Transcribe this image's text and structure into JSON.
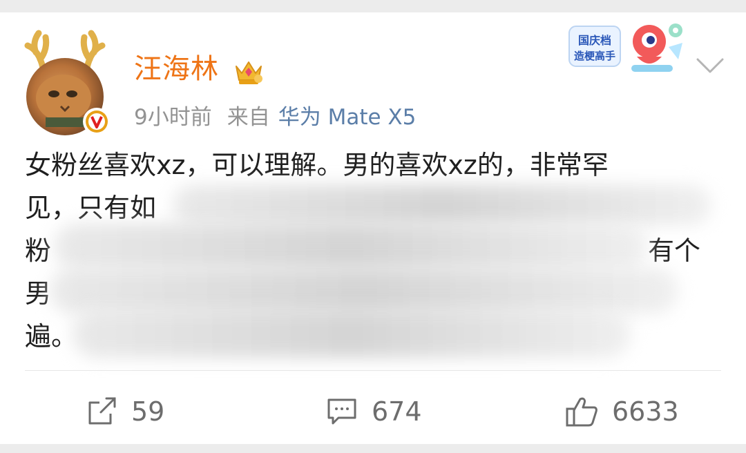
{
  "post": {
    "author": "汪海林",
    "time": "9小时前",
    "from_label": "来自",
    "device": "华为 Mate X5",
    "sticker_text_line1": "国庆档",
    "sticker_text_line2": "造梗高手",
    "content_lines": [
      "女粉丝喜欢xz，可以理解。男的喜欢xz的，非常罕",
      "见，只有如",
      "粉",
      "男",
      "遍。"
    ],
    "content_line2_tail": "有个"
  },
  "actions": {
    "repost_count": "59",
    "comment_count": "674",
    "like_count": "6633"
  },
  "colors": {
    "username": "#ee7416",
    "device_link": "#5b7ea8",
    "muted": "#939393",
    "verified_badge": "#e8a016"
  },
  "icons": {
    "repost": "share-icon",
    "comment": "comment-icon",
    "like": "thumbs-up-icon",
    "more": "chevron-down-icon",
    "verified": "verified-badge-icon",
    "vip": "crown-icon"
  }
}
